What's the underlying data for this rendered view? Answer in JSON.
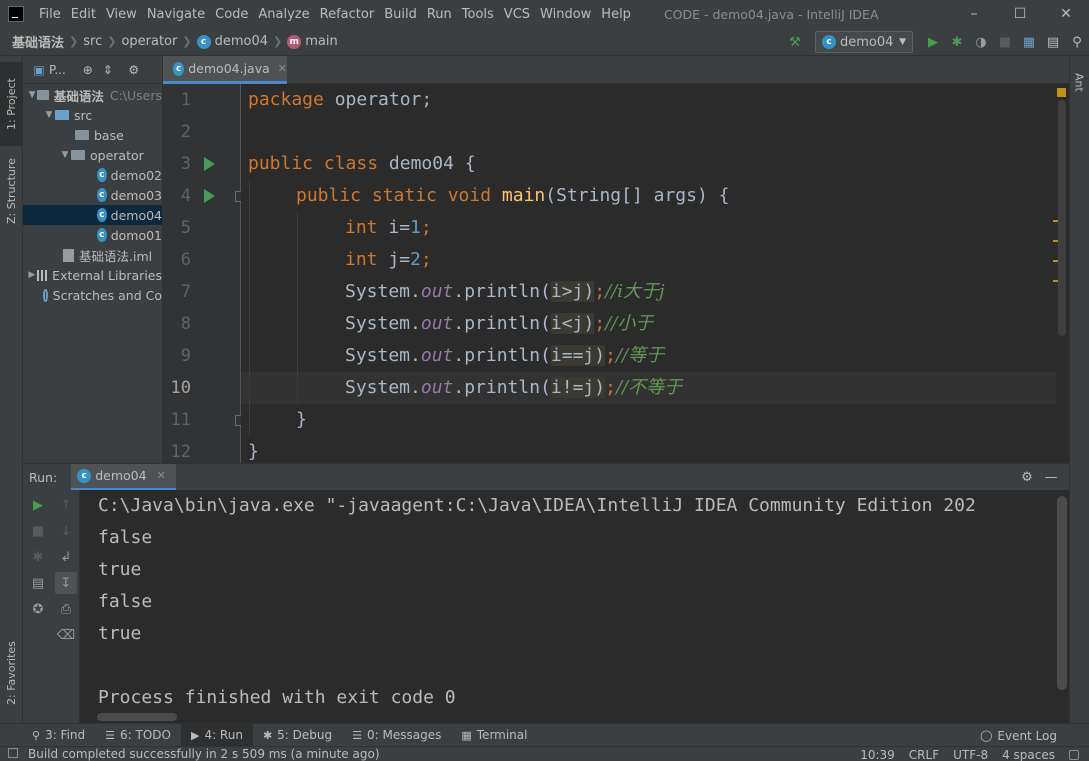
{
  "window": {
    "title": "CODE - demo04.java - IntelliJ IDEA",
    "menu": [
      "File",
      "Edit",
      "View",
      "Navigate",
      "Code",
      "Analyze",
      "Refactor",
      "Build",
      "Run",
      "Tools",
      "VCS",
      "Window",
      "Help"
    ]
  },
  "breadcrumb": {
    "project": "基础语法",
    "src": "src",
    "package": "operator",
    "class": "demo04",
    "method": "main"
  },
  "toolbar": {
    "run_config": "demo04"
  },
  "side_tabs": {
    "project": "1: Project",
    "structure": "Z: Structure",
    "favorites": "2: Favorites",
    "ant": "Ant"
  },
  "project_panel": {
    "title": "P...",
    "root": {
      "label": "基础语法",
      "path": "C:\\Users"
    },
    "src": "src",
    "base": "base",
    "operator": "operator",
    "files": [
      "demo02",
      "demo03",
      "demo04",
      "domo01"
    ],
    "iml": "基础语法.iml",
    "external_libraries": "External Libraries",
    "scratches": "Scratches and Co"
  },
  "editor": {
    "tab": "demo04.java",
    "line_numbers": [
      "1",
      "2",
      "3",
      "4",
      "5",
      "6",
      "7",
      "8",
      "9",
      "10",
      "11",
      "12"
    ],
    "lines": {
      "l1_kw": "package ",
      "l1_rest": "operator;",
      "l3_kw": "public class ",
      "l3_rest": "demo04 {",
      "l4_kw": "public static void ",
      "l4_fn": "main",
      "l4_rest": "(String[] args) {",
      "l5_kw": "int ",
      "l5_rest": "i=",
      "l5_num": "1",
      "l5_end": ";",
      "l6_kw": "int ",
      "l6_rest": "j=",
      "l6_num": "2",
      "l6_end": ";",
      "sys": "System.",
      "out": "out",
      "println": ".println(",
      "l7_arg": "i>j",
      "l7_cmt": "//i大于j",
      "l8_arg": "i<j",
      "l8_cmt": "//小于",
      "l9_arg": "i==j",
      "l9_cmt": "//等于",
      "l10_arg": "i!=j",
      "l10_cmt": "//不等于",
      "close_paren": ")",
      "semi": ";",
      "l11": "}",
      "l12": "}"
    }
  },
  "run_panel": {
    "label": "Run:",
    "tab": "demo04",
    "output": [
      "C:\\Java\\bin\\java.exe \"-javaagent:C:\\Java\\IDEA\\IntelliJ IDEA Community Edition 202",
      "false",
      "true",
      "false",
      "true",
      "",
      "Process finished with exit code 0"
    ]
  },
  "bottom_bar": {
    "find": "3: Find",
    "todo": "6: TODO",
    "run": "4: Run",
    "debug": "5: Debug",
    "messages": "0: Messages",
    "terminal": "Terminal",
    "event_log": "Event Log"
  },
  "status": {
    "message": "Build completed successfully in 2 s 509 ms (a minute ago)",
    "position": "10:39",
    "line_sep": "CRLF",
    "encoding": "UTF-8",
    "indent": "4 spaces"
  },
  "colors": {
    "keyword": "#cc7832",
    "method": "#ffc66d",
    "number": "#6897bb",
    "field": "#9876aa",
    "comment": "#629755",
    "run": "#499c54",
    "accent": "#4a88c7"
  }
}
